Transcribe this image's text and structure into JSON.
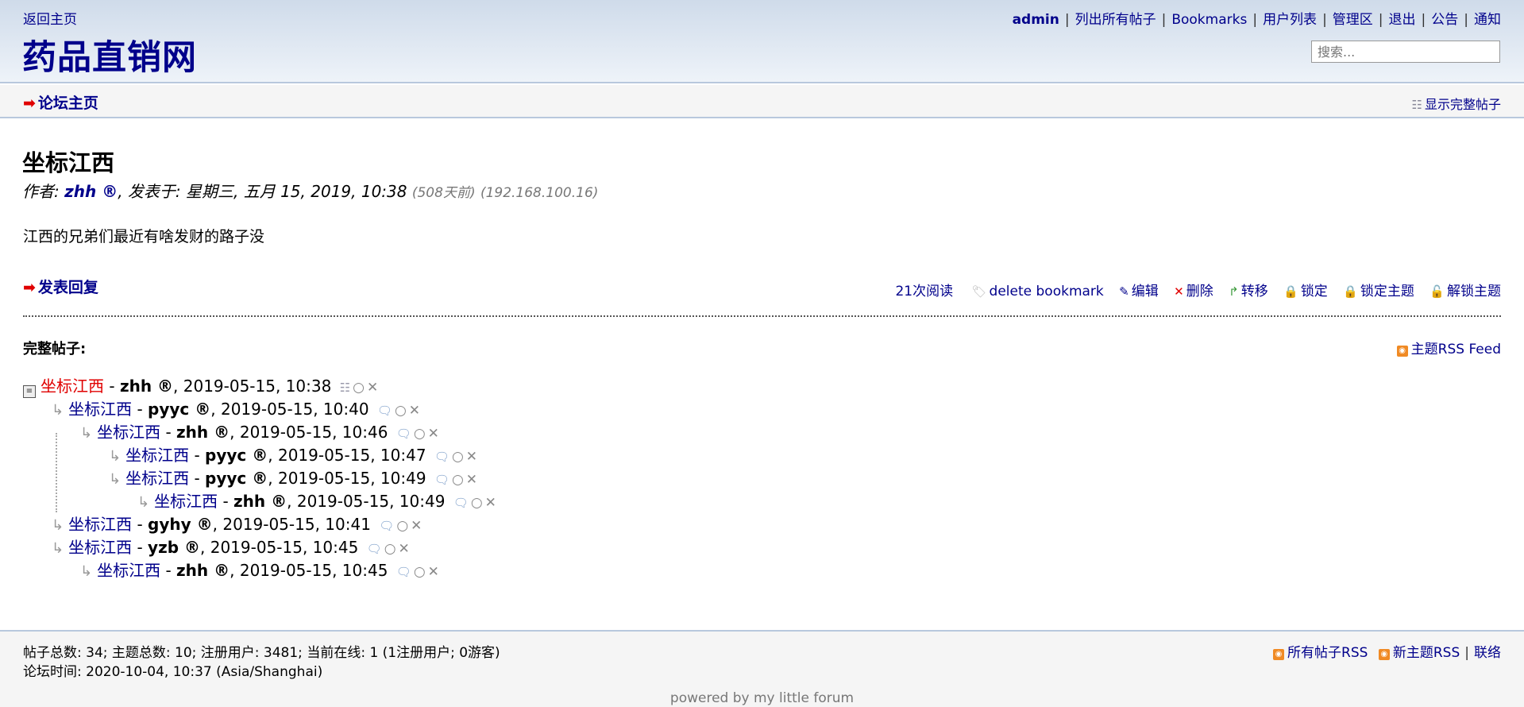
{
  "header": {
    "home_link": "返回主页",
    "site_title": "药品直销网",
    "user": "admin",
    "nav": [
      "列出所有帖子",
      "Bookmarks",
      "用户列表",
      "管理区",
      "退出",
      "公告",
      "通知"
    ],
    "search_placeholder": "搜索..."
  },
  "subnav": {
    "forum_home": "论坛主页",
    "show_full": "显示完整帖子"
  },
  "post": {
    "title": "坐标江西",
    "author_label": "作者: ",
    "author": "zhh ®",
    "posted_label": ", 发表于: 星期三, 五月 15, 2019, 10:38",
    "ago": "(508天前)",
    "ip": "(192.168.100.16)",
    "body": "江西的兄弟们最近有啥发财的路子没",
    "reply": "发表回复",
    "views": "21次阅读",
    "actions": [
      "delete bookmark",
      "编辑",
      "删除",
      "转移",
      "锁定",
      "锁定主题",
      "解锁主题"
    ]
  },
  "full": {
    "label": "完整帖子:",
    "rss": "主题RSS Feed"
  },
  "thread": [
    {
      "title": "坐标江西",
      "author": "zhh ®",
      "date": ", 2019-05-15, 10:38",
      "current": true
    },
    {
      "title": "坐标江西",
      "author": "pyyc ®",
      "date": ", 2019-05-15, 10:40"
    },
    {
      "title": "坐标江西",
      "author": "zhh ®",
      "date": ", 2019-05-15, 10:46"
    },
    {
      "title": "坐标江西",
      "author": "pyyc ®",
      "date": ", 2019-05-15, 10:47"
    },
    {
      "title": "坐标江西",
      "author": "pyyc ®",
      "date": ", 2019-05-15, 10:49"
    },
    {
      "title": "坐标江西",
      "author": "zhh ®",
      "date": ", 2019-05-15, 10:49"
    },
    {
      "title": "坐标江西",
      "author": "gyhy ®",
      "date": ", 2019-05-15, 10:41"
    },
    {
      "title": "坐标江西",
      "author": "yzb ®",
      "date": ", 2019-05-15, 10:45"
    },
    {
      "title": "坐标江西",
      "author": "zhh ®",
      "date": ", 2019-05-15, 10:45"
    }
  ],
  "footer": {
    "stats": "帖子总数: 34; 主题总数: 10; 注册用户: 3481; 当前在线: 1 (1注册用户; 0游客)",
    "time": "论坛时间: 2020-10-04, 10:37 (Asia/Shanghai)",
    "rss_all": "所有帖子RSS",
    "rss_new": "新主题RSS",
    "contact": "联络",
    "powered": "powered by my little forum"
  },
  "colors": {
    "link": "#00008b",
    "current": "#e00000",
    "header_bg": "#cfdbea",
    "rss": "#f08a24"
  }
}
